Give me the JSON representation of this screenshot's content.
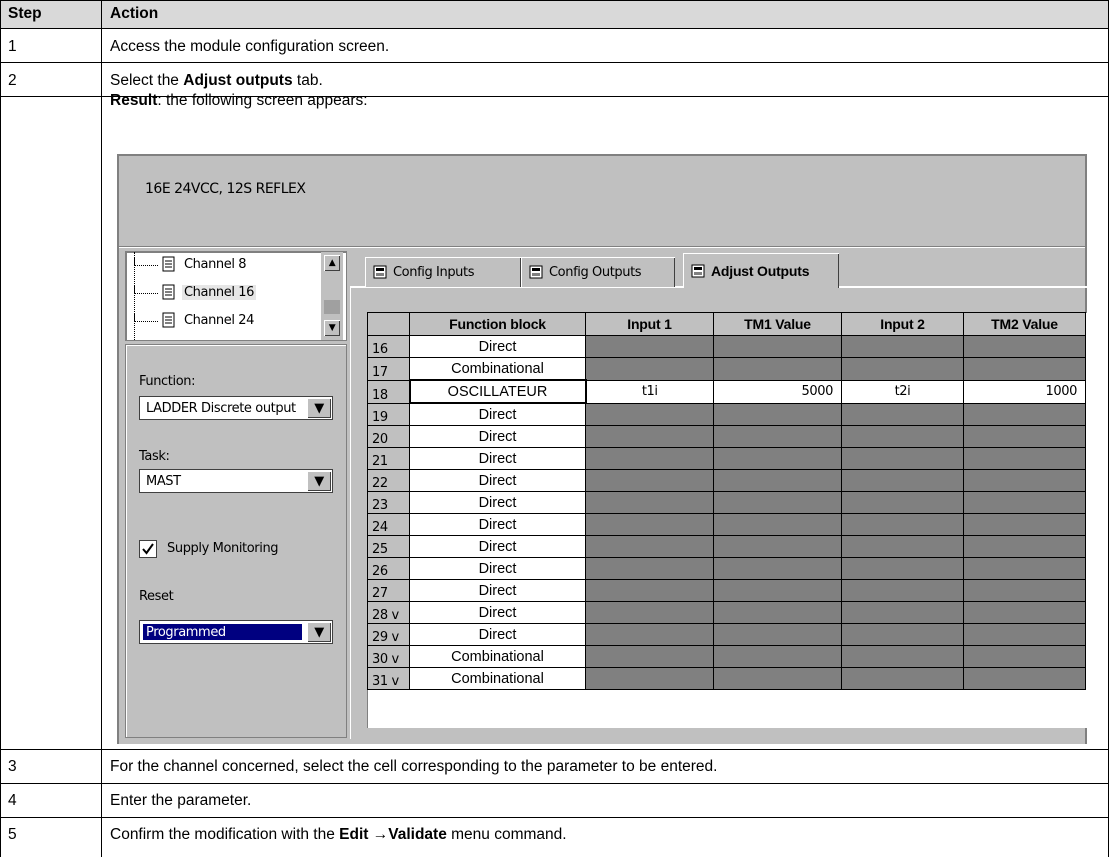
{
  "procedure": {
    "headers": {
      "step": "Step",
      "action": "Action"
    },
    "steps": [
      {
        "num": "1",
        "text": "Access the module configuration screen."
      },
      {
        "num": "2",
        "line1_pre": "Select the ",
        "line1_bold": "Adjust outputs",
        "line1_post": " tab.",
        "line2_bold": "Result",
        "line2_post": ": the following screen appears:"
      },
      {
        "num": "3",
        "text": "For the channel concerned, select the cell corresponding to the parameter to be entered."
      },
      {
        "num": "4",
        "text": "Enter the parameter."
      },
      {
        "num": "5",
        "pre": "Confirm the modification with the ",
        "bold1": "Edit",
        "arrow": " →",
        "bold2": "Validate",
        "post": " menu command."
      }
    ]
  },
  "screen": {
    "module_title": "16E 24VCC, 12S REFLEX",
    "channels": [
      "Channel 8",
      "Channel 16",
      "Channel 24"
    ],
    "selected_channel": "Channel 16",
    "function_label": "Function:",
    "function_value": "LADDER Discrete output",
    "task_label": "Task:",
    "task_value": "MAST",
    "supply_monitoring_label": "Supply Monitoring",
    "supply_monitoring_checked": true,
    "reset_label": "Reset",
    "reset_value": "Programmed",
    "tabs": [
      {
        "label": "Config Inputs",
        "active": false
      },
      {
        "label": "Config Outputs",
        "active": false
      },
      {
        "label": "Adjust Outputs",
        "active": true
      }
    ],
    "grid": {
      "columns": [
        "",
        "Function block",
        "Input 1",
        "TM1 Value",
        "Input 2",
        "TM2 Value"
      ],
      "rows": [
        {
          "ch": "16",
          "fb": "Direct"
        },
        {
          "ch": "17",
          "fb": "Combinational"
        },
        {
          "ch": "18",
          "fb": "OSCILLATEUR",
          "input1": "t1i",
          "tm1": "5000",
          "input2": "t2i",
          "tm2": "1000",
          "selected": true
        },
        {
          "ch": "19",
          "fb": "Direct"
        },
        {
          "ch": "20",
          "fb": "Direct"
        },
        {
          "ch": "21",
          "fb": "Direct"
        },
        {
          "ch": "22",
          "fb": "Direct"
        },
        {
          "ch": "23",
          "fb": "Direct"
        },
        {
          "ch": "24",
          "fb": "Direct"
        },
        {
          "ch": "25",
          "fb": "Direct"
        },
        {
          "ch": "26",
          "fb": "Direct"
        },
        {
          "ch": "27",
          "fb": "Direct"
        },
        {
          "ch": "28 v",
          "fb": "Direct"
        },
        {
          "ch": "29 v",
          "fb": "Direct"
        },
        {
          "ch": "30 v",
          "fb": "Combinational"
        },
        {
          "ch": "31 v",
          "fb": "Combinational"
        }
      ]
    },
    "colors": {
      "window_bg": "#c0c0c0",
      "disabled_cell": "#808080",
      "selection": "#000080"
    }
  }
}
